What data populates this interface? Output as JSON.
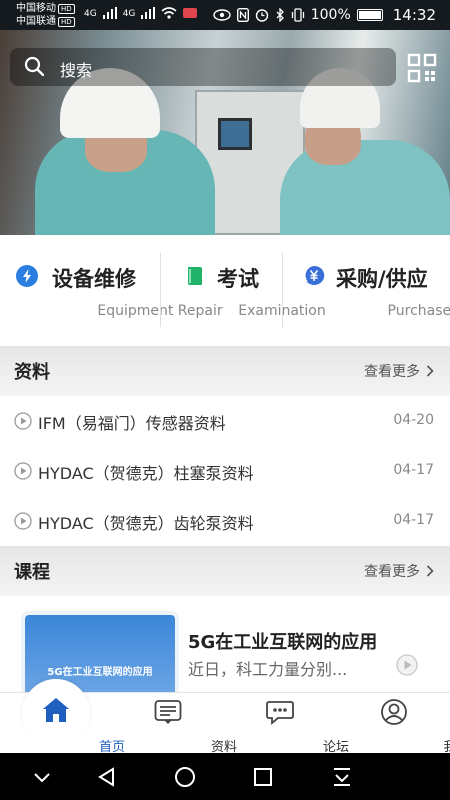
{
  "status_bar": {
    "carrier1": "中国移动",
    "carrier2": "中国联通",
    "hd": "HD",
    "net1": "4G",
    "net2": "4G",
    "battery": "100%",
    "time": "14:32"
  },
  "search": {
    "placeholder": "搜索"
  },
  "banner": {
    "slides": 2,
    "active": 0
  },
  "categories": [
    {
      "title": "设备维修",
      "subtitle": "Equipment Repair",
      "icon": "lightning-icon",
      "color": "#2a7de1"
    },
    {
      "title": "考试",
      "subtitle": "Examination",
      "icon": "book-icon",
      "color": "#20b46a"
    },
    {
      "title": "采购/供应",
      "subtitle": "Purchase / Supply",
      "icon": "yen-icon",
      "color": "#3a6fd8"
    }
  ],
  "materials": {
    "title": "资料",
    "more": "查看更多",
    "items": [
      {
        "title": "IFM（易福门）传感器资料",
        "date": "04-20"
      },
      {
        "title": "HYDAC（贺德克）柱塞泵资料",
        "date": "04-17"
      },
      {
        "title": "HYDAC（贺德克）齿轮泵资料",
        "date": "04-17"
      }
    ]
  },
  "courses": {
    "title": "课程",
    "more": "查看更多",
    "items": [
      {
        "thumb_text": "5G在工业互联网的应用",
        "title": "5G在工业互联网的应用",
        "desc": "近日，科工力量分别..."
      }
    ]
  },
  "bottom_nav": [
    {
      "label": "首页",
      "icon": "home-icon",
      "active": true
    },
    {
      "label": "资料",
      "icon": "document-icon",
      "active": false
    },
    {
      "label": "论坛",
      "icon": "chat-icon",
      "active": false
    },
    {
      "label": "我",
      "icon": "profile-icon",
      "active": false
    }
  ],
  "colors": {
    "accent": "#1f5fbf",
    "header_bg": "#151a1e"
  }
}
